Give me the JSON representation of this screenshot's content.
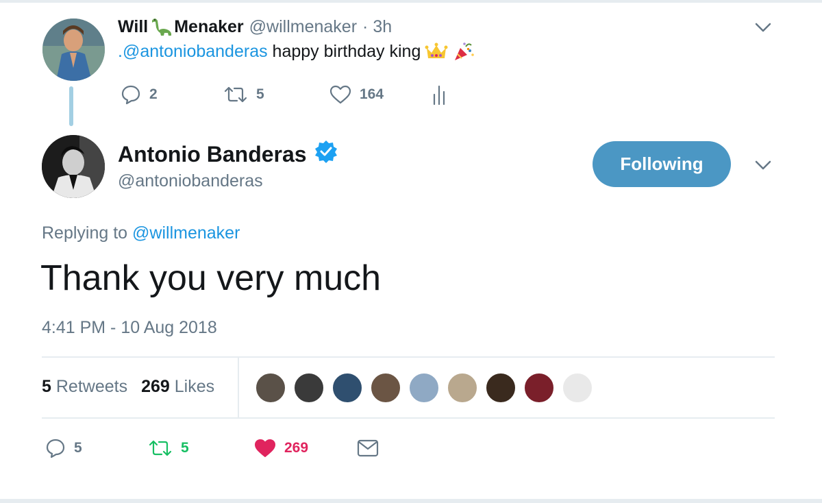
{
  "parent_tweet": {
    "name_first": "Will",
    "name_last": "Menaker",
    "handle": "@willmenaker",
    "time": "· 3h",
    "mention": ".@antoniobanderas",
    "text": "happy birthday king",
    "emoji": [
      "crown-emoji",
      "party-popper-emoji"
    ],
    "replies": "2",
    "retweets": "5",
    "likes": "164"
  },
  "main_tweet": {
    "name": "Antonio Banderas",
    "handle": "@antoniobanderas",
    "follow_label": "Following",
    "replying_prefix": "Replying to",
    "replying_handle": "@willmenaker",
    "text": "Thank you very much",
    "timestamp": "4:41 PM - 10 Aug 2018",
    "retweet_count": "5",
    "retweet_label": "Retweets",
    "like_count": "269",
    "like_label": "Likes",
    "liker_colors": [
      "#5a5148",
      "#3a3a3a",
      "#2f4f6f",
      "#6b5544",
      "#8fa9c4",
      "#b9a88e",
      "#3a2a1e",
      "#7a1f2a",
      "#e9e9e9"
    ],
    "replies": "5",
    "retweets": "5",
    "likes": "269"
  },
  "colors": {
    "link": "#1b95e0",
    "gray": "#657786",
    "follow_button": "#4b97c4",
    "retweet_green": "#17bf63",
    "like_red": "#e0245e"
  }
}
